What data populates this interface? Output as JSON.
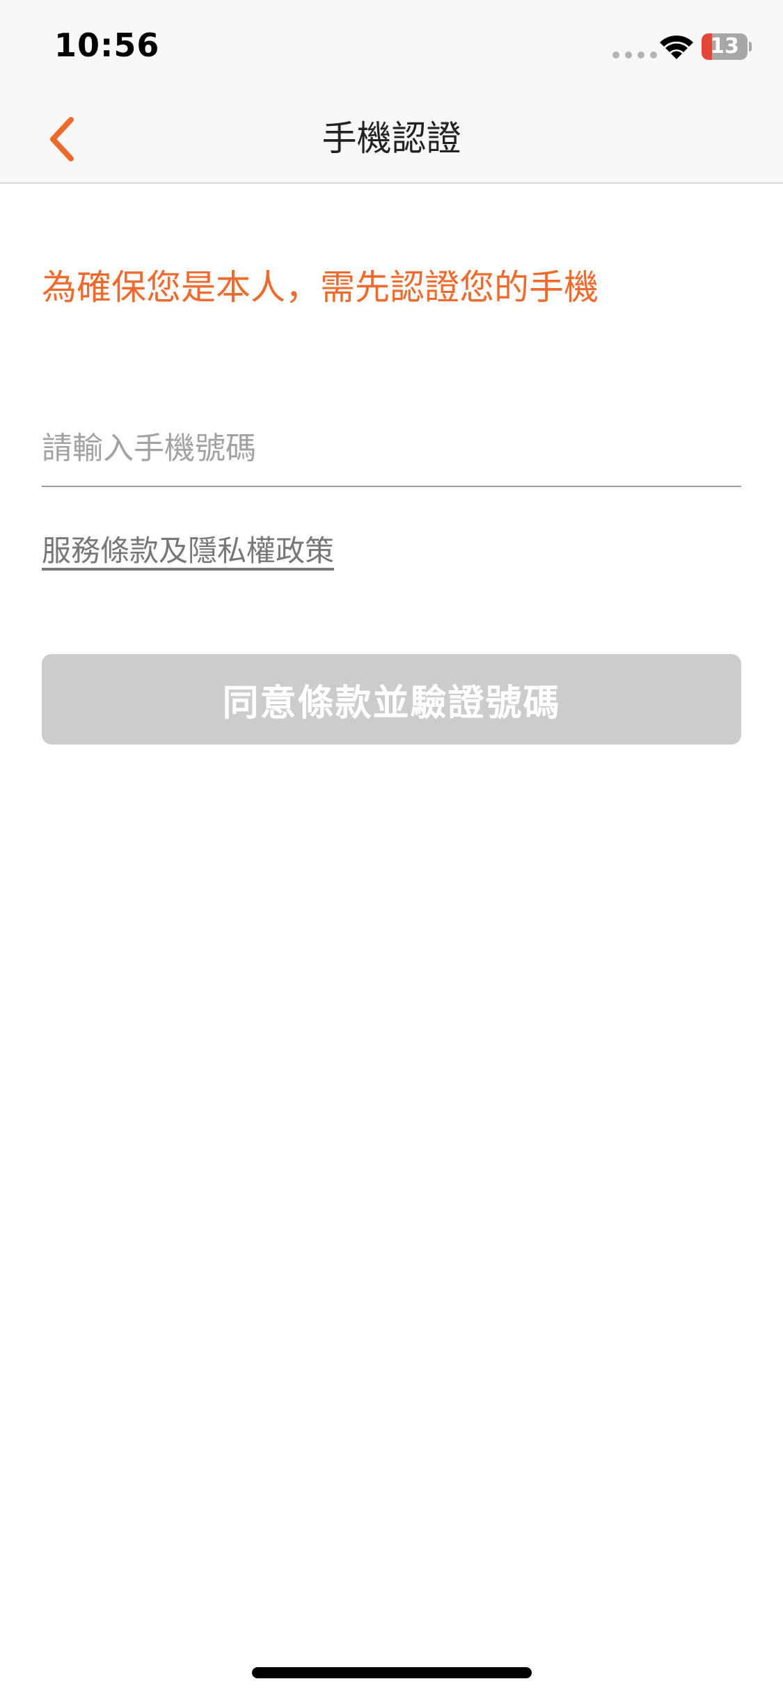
{
  "status_bar": {
    "time": "10:56",
    "battery_level": "13",
    "battery_percent": 13
  },
  "nav": {
    "title": "手機認證",
    "back_icon": "chevron-left-icon"
  },
  "content": {
    "notice": "為確保您是本人，需先認證您的手機",
    "phone_input": {
      "value": "",
      "placeholder": "請輸入手機號碼"
    },
    "terms_link": "服務條款及隱私權政策",
    "agree_button": "同意條款並驗證號碼"
  },
  "colors": {
    "accent": "#ee6b2d",
    "button_disabled": "#cccccc",
    "nav_background": "#f8f8f8",
    "battery_low": "#e6453a"
  }
}
